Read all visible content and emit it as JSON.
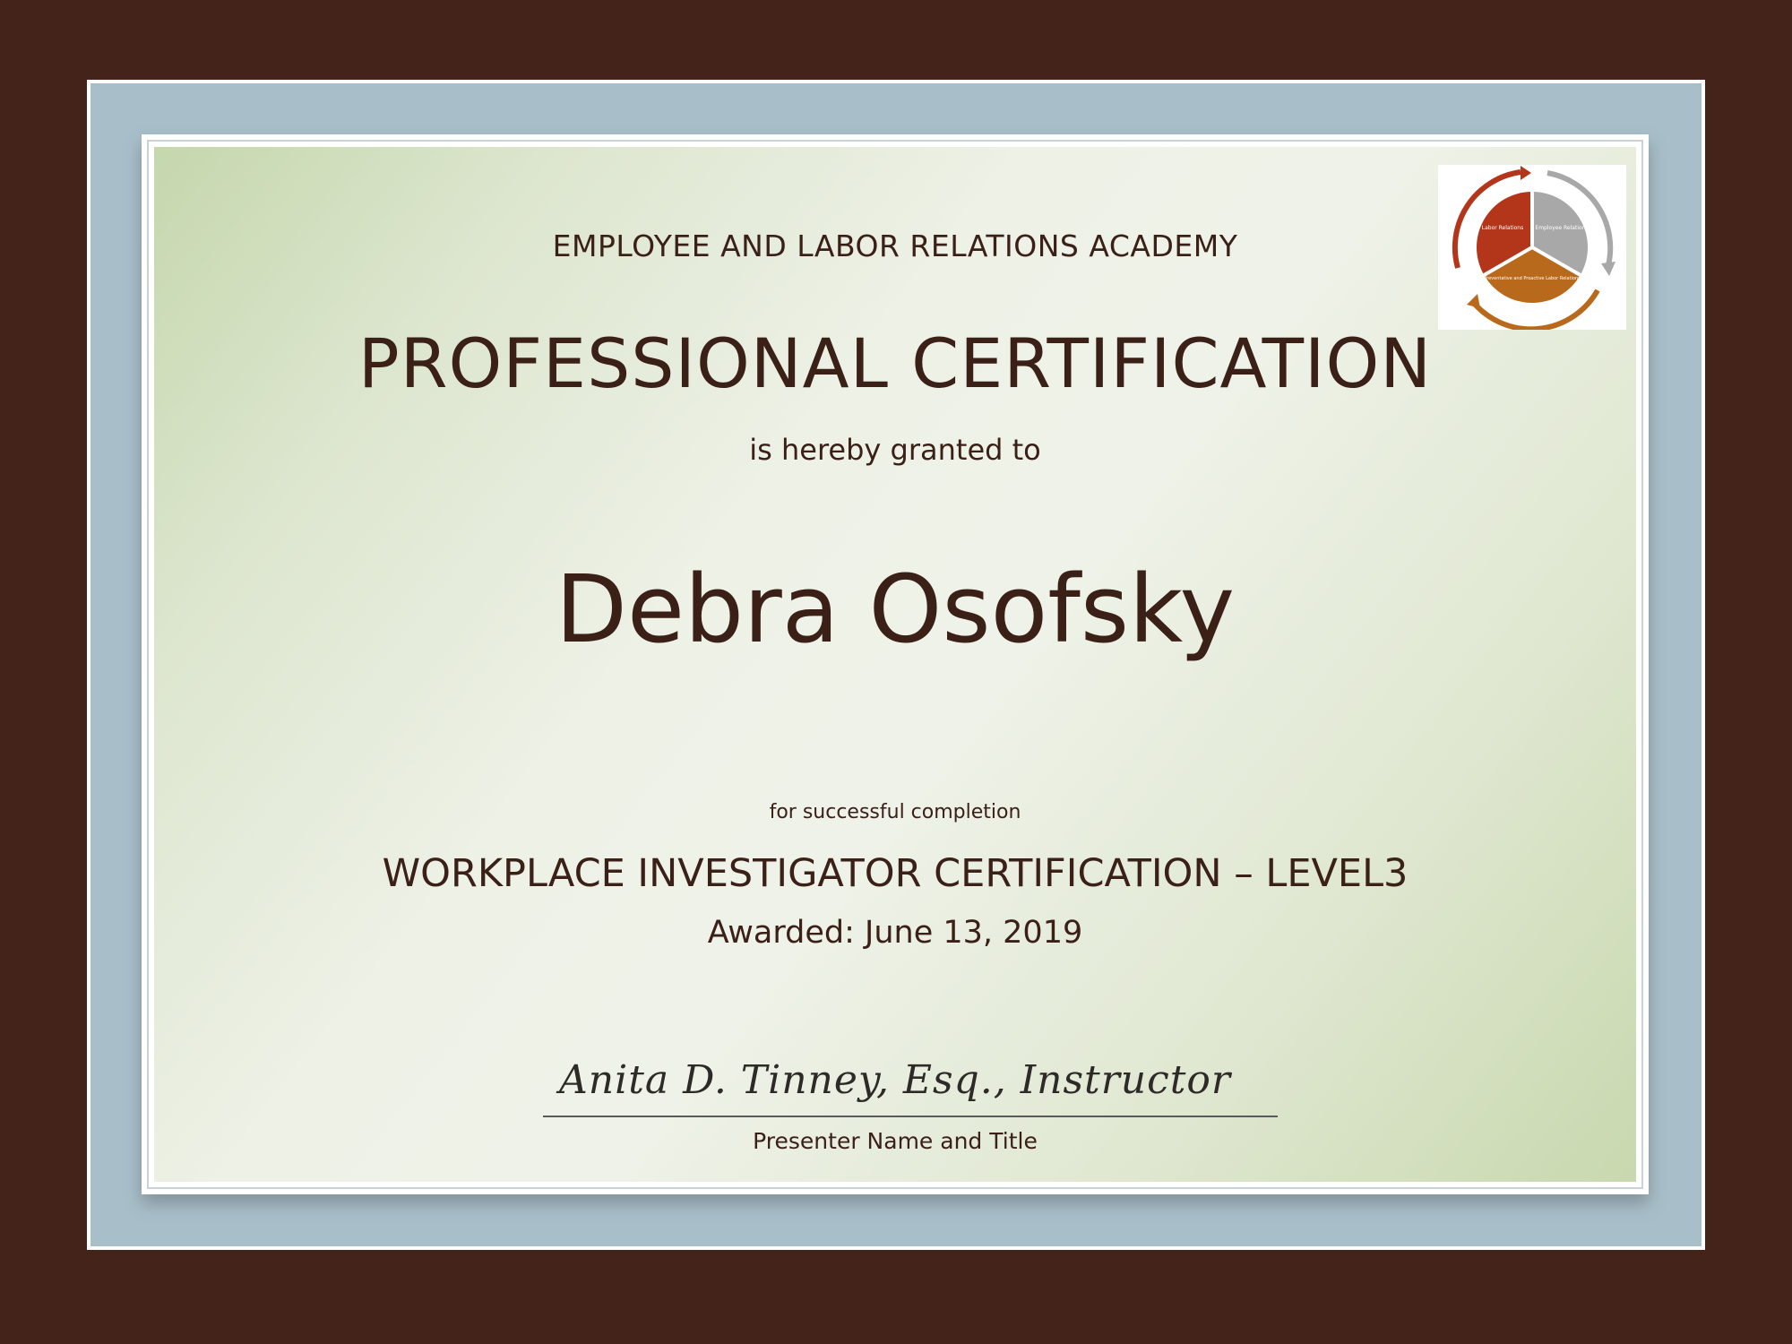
{
  "certificate": {
    "academy": "EMPLOYEE AND LABOR RELATIONS ACADEMY",
    "title": "PROFESSIONAL CERTIFICATION",
    "granted_text": "is hereby granted to",
    "recipient": "Debra Osofsky",
    "completion_text": "for successful completion",
    "course": "WORKPLACE INVESTIGATOR CERTIFICATION – LEVEL3",
    "awarded": "Awarded: June 13, 2019",
    "signature": "Anita D. Tinney, Esq., Instructor",
    "signature_caption": "Presenter Name and Title"
  },
  "logo": {
    "segments": [
      {
        "label": "Labor Relations",
        "color": "#b3361b"
      },
      {
        "label": "Employee Relations",
        "color": "#a8a8a8"
      },
      {
        "label": "Preventative and Proactive Labor Relations",
        "color": "#b8691c"
      }
    ]
  },
  "colors": {
    "frame": "#44231b",
    "mat": "#a8bfc9",
    "text": "#3b2018"
  }
}
